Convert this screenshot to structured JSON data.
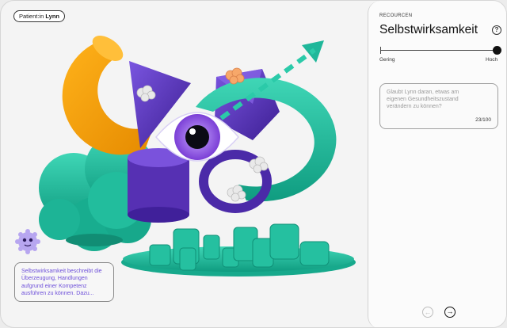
{
  "patient": {
    "prefix": "Patient:in",
    "name": "Lynn"
  },
  "description": "Selbstwirksamkeit beschreibt die Überzeugung, Handlungen aufgrund einer Kompetenz ausführen zu können. Dazu...",
  "panel": {
    "kicker": "RECOURCEN",
    "title": "Selbstwirksamkeit",
    "help_icon": "?",
    "slider": {
      "min_label": "Gering",
      "max_label": "Hoch",
      "value": 1.0
    },
    "answer": {
      "placeholder": "Glaubt Lynn daran, etwas am eigenen Gesundheitszustand verändern zu können?",
      "count": "23/100"
    },
    "nav": {
      "prev_icon": "←",
      "next_icon": "→"
    }
  },
  "colors": {
    "teal": "#1fb79a",
    "purple": "#5a35b8",
    "orange": "#f5a100",
    "lilac": "#b7a6f0",
    "text_accent": "#6d4fd9"
  }
}
